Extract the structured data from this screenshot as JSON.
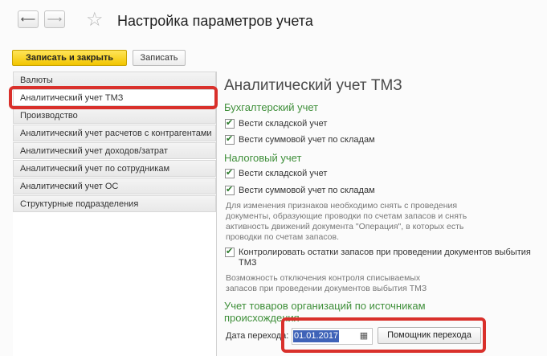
{
  "header": {
    "back_icon": "arrow-left-icon",
    "forward_icon": "arrow-right-icon",
    "favorite_icon": "star-icon",
    "title": "Настройка параметров учета"
  },
  "toolbar": {
    "save_close_label": "Записать и закрыть",
    "save_label": "Записать"
  },
  "sidebar": {
    "items": [
      {
        "label": "Валюты"
      },
      {
        "label": "Аналитический учет ТМЗ"
      },
      {
        "label": "Производство"
      },
      {
        "label": "Аналитический учет расчетов с контрагентами"
      },
      {
        "label": "Аналитический учет доходов/затрат"
      },
      {
        "label": "Аналитический учет по сотрудникам"
      },
      {
        "label": "Аналитический учет ОС"
      },
      {
        "label": "Структурные подразделения"
      }
    ],
    "active_index": 1
  },
  "main": {
    "heading": "Аналитический учет ТМЗ",
    "accounting": {
      "title": "Бухгалтерский учет",
      "warehouse_label": "Вести складской учет",
      "warehouse_checked": true,
      "sum_label": "Вести суммовой учет по складам",
      "sum_checked": true
    },
    "tax": {
      "title": "Налоговый учет",
      "warehouse_label": "Вести складской учет",
      "warehouse_checked": true,
      "sum_label": "Вести суммовой учет по складам",
      "sum_checked": true
    },
    "note1": [
      "Для изменения признаков необходимо снять с проведения",
      "документы, образующие проводки по счетам запасов и снять",
      "активность движений документа \"Операция\", в которых есть",
      "проводки по счетам запасов."
    ],
    "control": {
      "line1": "Контролировать остатки запасов при проведении документов выбытия",
      "line2": "ТМЗ",
      "checked": true
    },
    "note2": [
      "Возможность отключения контроля списываемых",
      "запасов при проведении документов выбытия ТМЗ"
    ],
    "sources": {
      "title_line1": "Учет товаров организаций по источникам",
      "title_line2": "происхождения"
    },
    "transition": {
      "date_label": "Дата перехода:",
      "date_value": "01.01.2017",
      "calendar_icon": "calendar-icon",
      "helper_button": "Помощник перехода"
    }
  },
  "colors": {
    "highlight": "#d9302b",
    "section_title": "#3f8f3a",
    "primary_button": "#f2c500"
  }
}
